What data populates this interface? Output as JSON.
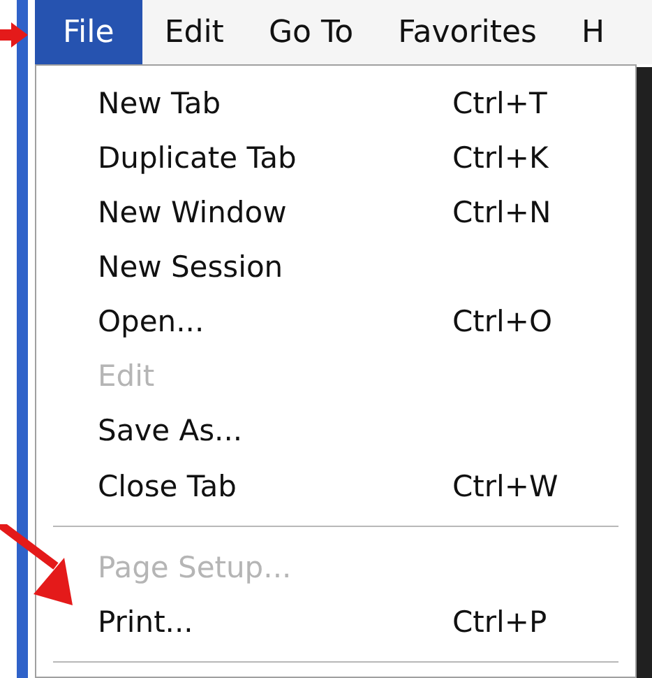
{
  "menu_bar": [
    {
      "label": "File",
      "selected": true
    },
    {
      "label": "Edit",
      "selected": false
    },
    {
      "label": "Go To",
      "selected": false
    },
    {
      "label": "Favorites",
      "selected": false
    },
    {
      "label": "H",
      "selected": false
    }
  ],
  "file_menu": [
    {
      "kind": "item",
      "label": "New Tab",
      "shortcut": "Ctrl+T",
      "disabled": false
    },
    {
      "kind": "item",
      "label": "Duplicate Tab",
      "shortcut": "Ctrl+K",
      "disabled": false
    },
    {
      "kind": "item",
      "label": "New Window",
      "shortcut": "Ctrl+N",
      "disabled": false
    },
    {
      "kind": "item",
      "label": "New Session",
      "disabled": false
    },
    {
      "kind": "item",
      "label": "Open...",
      "shortcut": "Ctrl+O",
      "disabled": false
    },
    {
      "kind": "item",
      "label": "Edit",
      "disabled": true
    },
    {
      "kind": "item",
      "label": "Save As...",
      "disabled": false
    },
    {
      "kind": "item",
      "label": "Close Tab",
      "shortcut": "Ctrl+W",
      "disabled": false
    },
    {
      "kind": "separator"
    },
    {
      "kind": "item",
      "label": "Page Setup...",
      "disabled": true
    },
    {
      "kind": "item",
      "label": "Print...",
      "shortcut": "Ctrl+P",
      "disabled": false
    },
    {
      "kind": "separator"
    }
  ]
}
